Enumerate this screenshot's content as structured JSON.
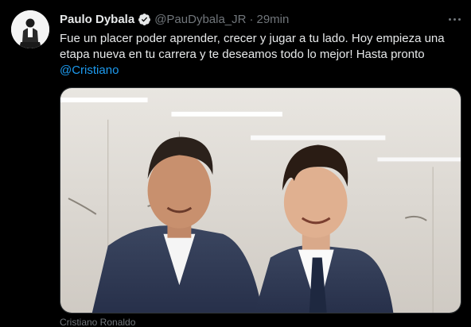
{
  "tweet": {
    "author_name": "Paulo Dybala",
    "handle": "@PauDybala_JR",
    "separator": "·",
    "time": "29min",
    "text_line1": "Fue un placer poder aprender, crecer y jugar a tu lado. Hoy empieza una",
    "text_line2": "etapa nueva en tu carrera y te deseamos todo lo mejor! Hasta pronto",
    "mention": "@Cristiano",
    "media_caption": "Cristiano Ronaldo"
  },
  "icons": {
    "verified": "verified-badge-icon",
    "more": "more-options-icon"
  },
  "colors": {
    "background": "#000000",
    "text": "#e7e9ea",
    "secondary": "#71767b",
    "link": "#1d9bf0"
  }
}
